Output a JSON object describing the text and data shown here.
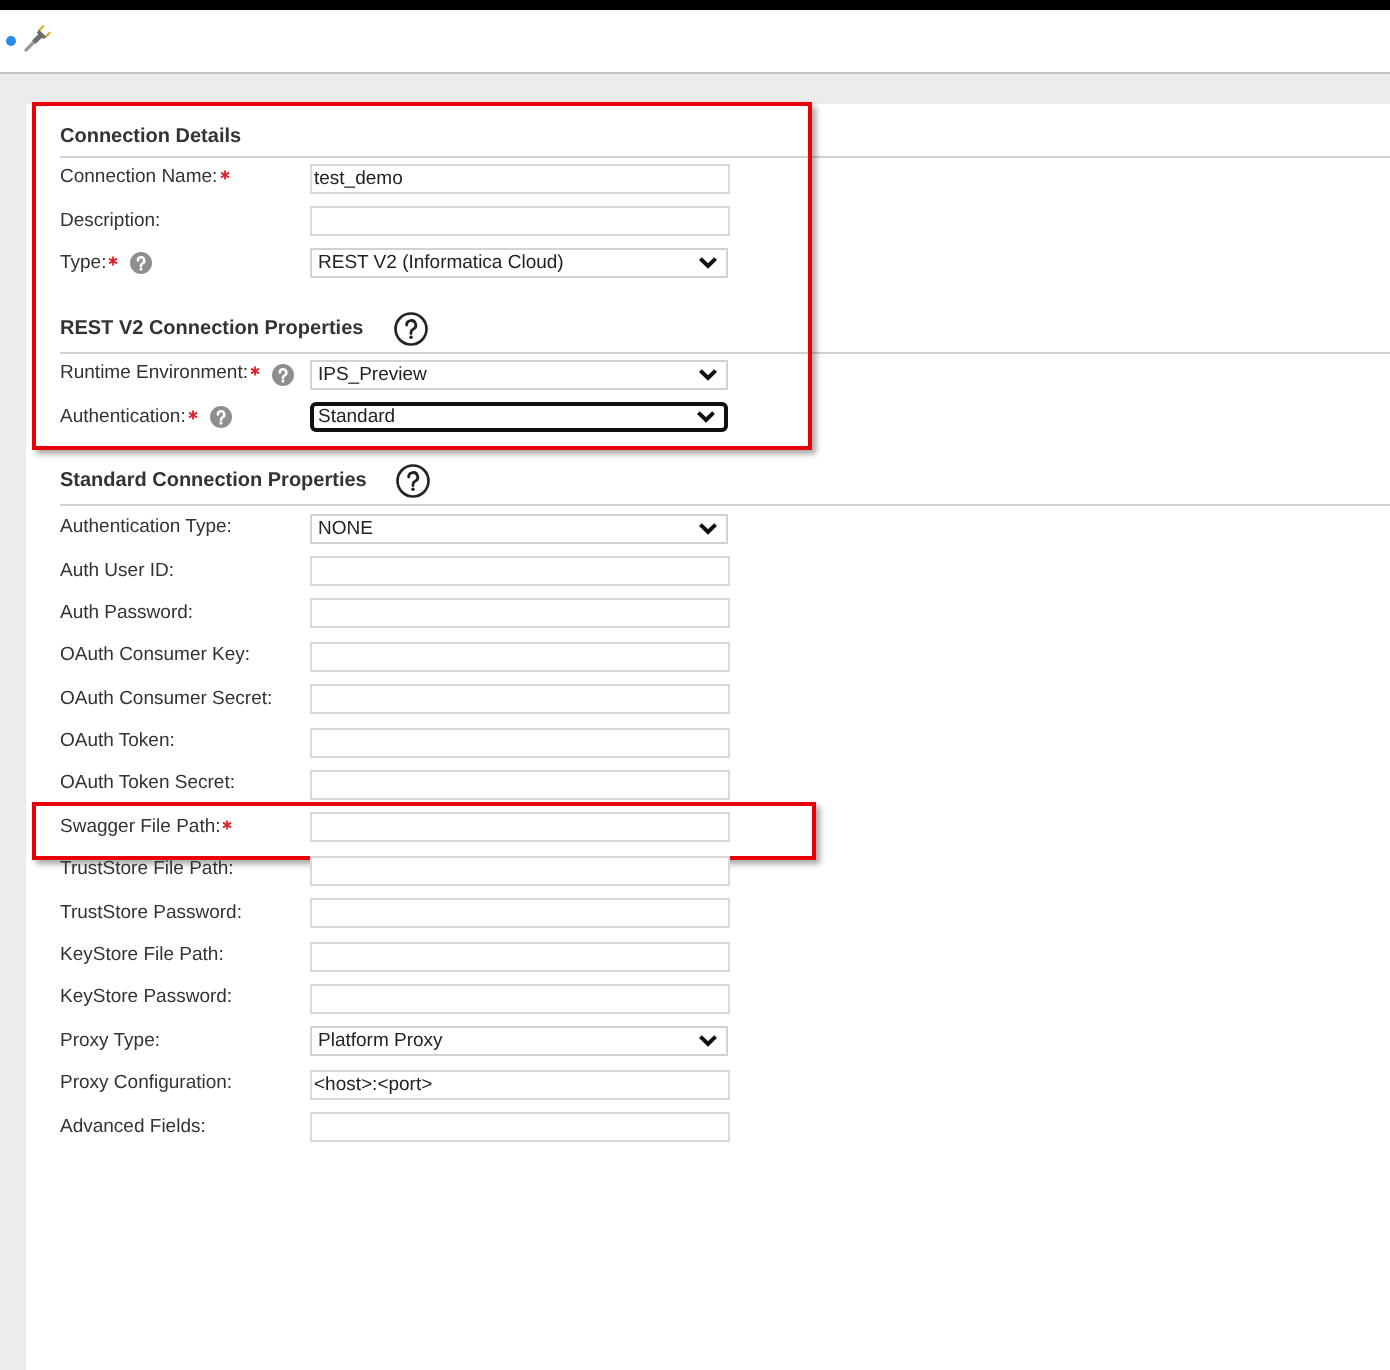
{
  "sections": [
    {
      "title": "Connection Details",
      "help": false,
      "highlighted": true,
      "fields": [
        {
          "label": "Connection Name:",
          "required": true,
          "help": false,
          "kind": "text",
          "value": "test_demo",
          "focused": false,
          "highlighted": false
        },
        {
          "label": "Description:",
          "required": false,
          "help": false,
          "kind": "text",
          "focused": false,
          "highlighted": false
        },
        {
          "label": "Type:",
          "required": true,
          "help": true,
          "kind": "select",
          "value": "REST V2 (Informatica Cloud)",
          "focused": false,
          "highlighted": false
        }
      ]
    },
    {
      "title": "REST V2 Connection Properties",
      "help": true,
      "highlighted": true,
      "fields": [
        {
          "label": "Runtime Environment:",
          "required": true,
          "help": true,
          "kind": "select",
          "value": "IPS_Preview",
          "focused": false,
          "highlighted": false
        },
        {
          "label": "Authentication:",
          "required": true,
          "help": true,
          "kind": "select",
          "value": "Standard",
          "focused": true,
          "highlighted": false
        }
      ]
    },
    {
      "title": "Standard Connection Properties",
      "help": true,
      "highlighted": false,
      "fields": [
        {
          "label": "Authentication Type:",
          "required": false,
          "help": false,
          "kind": "select",
          "value": "NONE",
          "focused": false,
          "highlighted": false
        },
        {
          "label": "Auth User ID:",
          "required": false,
          "help": false,
          "kind": "text",
          "focused": false,
          "highlighted": false
        },
        {
          "label": "Auth Password:",
          "required": false,
          "help": false,
          "kind": "text",
          "focused": false,
          "highlighted": false
        },
        {
          "label": "OAuth Consumer Key:",
          "required": false,
          "help": false,
          "kind": "text",
          "focused": false,
          "highlighted": false
        },
        {
          "label": "OAuth Consumer Secret:",
          "required": false,
          "help": false,
          "kind": "text",
          "focused": false,
          "highlighted": false
        },
        {
          "label": "OAuth Token:",
          "required": false,
          "help": false,
          "kind": "text",
          "focused": false,
          "highlighted": false
        },
        {
          "label": "OAuth Token Secret:",
          "required": false,
          "help": false,
          "kind": "text",
          "focused": false,
          "highlighted": false
        },
        {
          "label": "Swagger File Path:",
          "required": true,
          "help": false,
          "kind": "text",
          "focused": false,
          "highlighted": true
        },
        {
          "label": "TrustStore File Path:",
          "required": false,
          "help": false,
          "kind": "text",
          "focused": false,
          "highlighted": false
        },
        {
          "label": "TrustStore Password:",
          "required": false,
          "help": false,
          "kind": "text",
          "focused": false,
          "highlighted": false
        },
        {
          "label": "KeyStore File Path:",
          "required": false,
          "help": false,
          "kind": "text",
          "focused": false,
          "highlighted": false
        },
        {
          "label": "KeyStore Password:",
          "required": false,
          "help": false,
          "kind": "text",
          "focused": false,
          "highlighted": false
        },
        {
          "label": "Proxy Type:",
          "required": false,
          "help": false,
          "kind": "select",
          "value": "Platform Proxy",
          "focused": false,
          "highlighted": false
        },
        {
          "label": "Proxy Configuration:",
          "required": false,
          "help": false,
          "kind": "text",
          "value": "<host>:<port>",
          "focused": false,
          "highlighted": false
        },
        {
          "label": "Advanced Fields:",
          "required": false,
          "help": false,
          "kind": "text",
          "focused": false,
          "highlighted": false
        }
      ]
    }
  ]
}
